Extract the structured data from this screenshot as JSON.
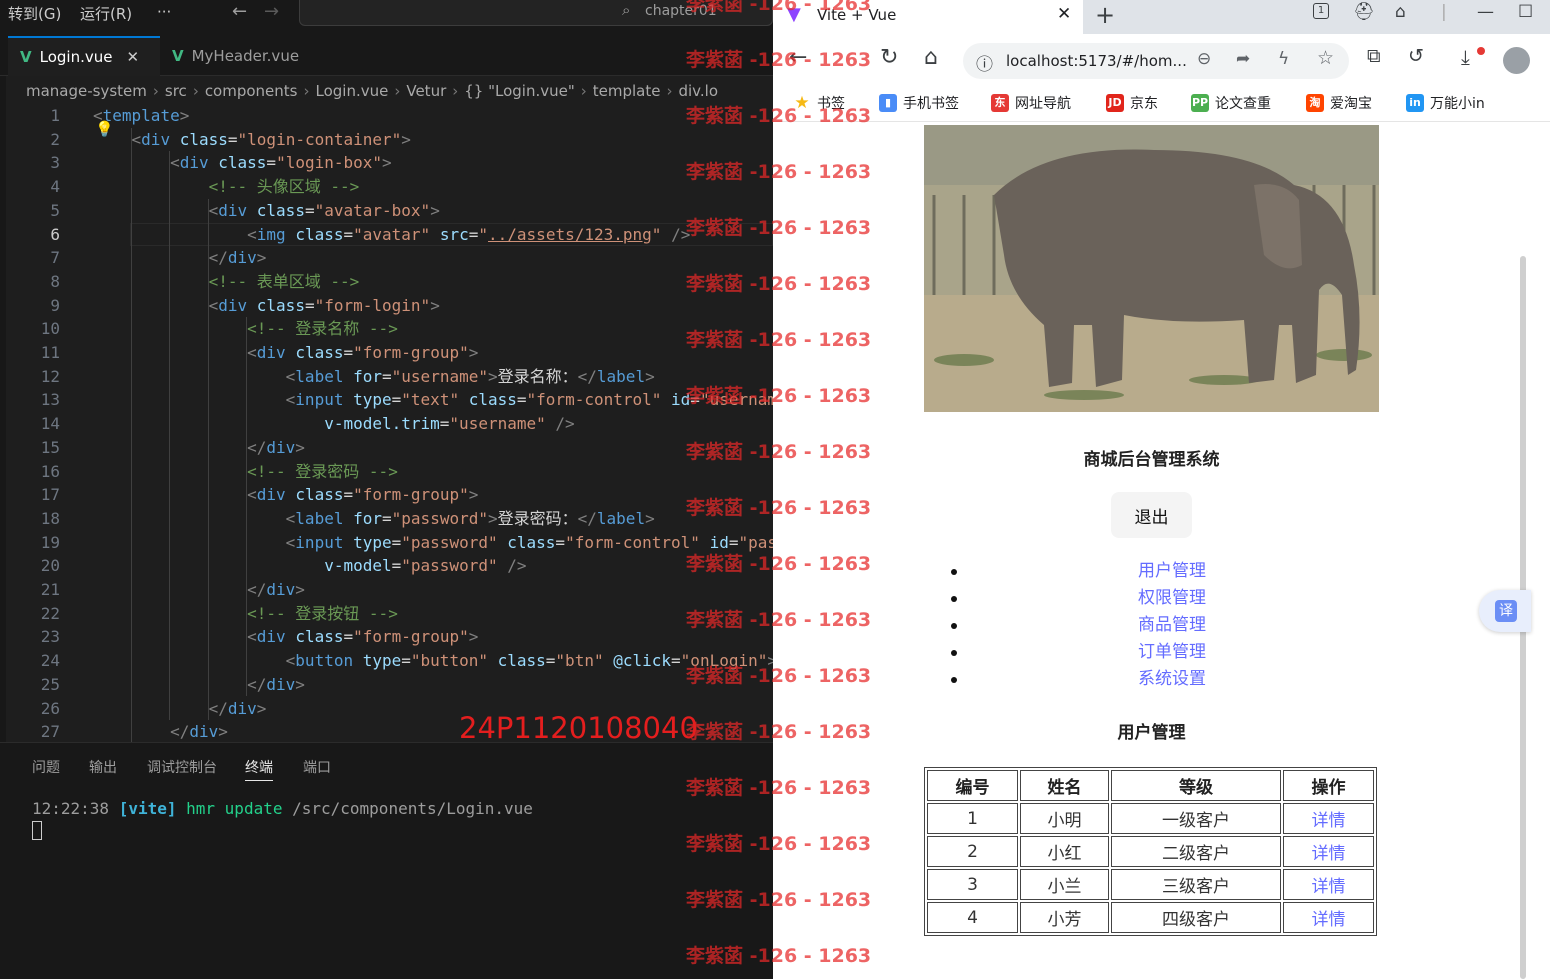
{
  "vscode": {
    "menu": [
      "转到(G)",
      "运行(R)",
      "···"
    ],
    "search_text": "chapter01",
    "tabs": [
      {
        "label": "Login.vue",
        "active": true
      },
      {
        "label": "MyHeader.vue",
        "active": false
      }
    ],
    "tab_close": "✕",
    "breadcrumb": [
      "manage-system",
      "src",
      "components",
      "Login.vue",
      "Vetur",
      "{} \"Login.vue\"",
      "template",
      "div.lo"
    ],
    "code_lines": [
      {
        "n": "1",
        "html": "<span class='p'>&lt;</span><span class='t'>template</span><span class='p'>&gt;</span>"
      },
      {
        "n": "2",
        "html": "    <span class='p'>&lt;</span><span class='t'>div</span> <span class='a'>class</span><span class='x'>=</span><span class='s'>\"login-container\"</span><span class='p'>&gt;</span>"
      },
      {
        "n": "3",
        "html": "        <span class='p'>&lt;</span><span class='t'>div</span> <span class='a'>class</span><span class='x'>=</span><span class='s'>\"login-box\"</span><span class='p'>&gt;</span>"
      },
      {
        "n": "4",
        "html": "            <span class='c'>&lt;!-- 头像区域 --&gt;</span>"
      },
      {
        "n": "5",
        "html": "            <span class='p'>&lt;</span><span class='t'>div</span> <span class='a'>class</span><span class='x'>=</span><span class='s'>\"avatar-box\"</span><span class='p'>&gt;</span>"
      },
      {
        "n": "6",
        "html": "                <span class='p'>&lt;</span><span class='t'>img</span> <span class='a'>class</span><span class='x'>=</span><span class='s'>\"avatar\"</span> <span class='a'>src</span><span class='x'>=</span><span class='s'>\"<u>../assets/123.png</u>\"</span> <span class='p'>/&gt;</span>",
        "current": true
      },
      {
        "n": "7",
        "html": "            <span class='p'>&lt;/</span><span class='t'>div</span><span class='p'>&gt;</span>"
      },
      {
        "n": "8",
        "html": "            <span class='c'>&lt;!-- 表单区域 --&gt;</span>"
      },
      {
        "n": "9",
        "html": "            <span class='p'>&lt;</span><span class='t'>div</span> <span class='a'>class</span><span class='x'>=</span><span class='s'>\"form-login\"</span><span class='p'>&gt;</span>"
      },
      {
        "n": "10",
        "html": "                <span class='c'>&lt;!-- 登录名称 --&gt;</span>"
      },
      {
        "n": "11",
        "html": "                <span class='p'>&lt;</span><span class='t'>div</span> <span class='a'>class</span><span class='x'>=</span><span class='s'>\"form-group\"</span><span class='p'>&gt;</span>"
      },
      {
        "n": "12",
        "html": "                    <span class='p'>&lt;</span><span class='t'>label</span> <span class='a'>for</span><span class='x'>=</span><span class='s'>\"username\"</span><span class='p'>&gt;</span><span class='x'>登录名称：</span><span class='p'>&lt;/</span><span class='t'>label</span><span class='p'>&gt;</span>"
      },
      {
        "n": "13",
        "html": "                    <span class='p'>&lt;</span><span class='t'>input</span> <span class='a'>type</span><span class='x'>=</span><span class='s'>\"text\"</span> <span class='a'>class</span><span class='x'>=</span><span class='s'>\"form-control\"</span> <span class='a'>id</span><span class='x'>=</span><span class='s'>\"usernam</span>"
      },
      {
        "n": "14",
        "html": "                        <span class='a'>v-model.trim</span><span class='x'>=</span><span class='s'>\"username\"</span> <span class='p'>/&gt;</span>"
      },
      {
        "n": "15",
        "html": "                <span class='p'>&lt;/</span><span class='t'>div</span><span class='p'>&gt;</span>"
      },
      {
        "n": "16",
        "html": "                <span class='c'>&lt;!-- 登录密码 --&gt;</span>"
      },
      {
        "n": "17",
        "html": "                <span class='p'>&lt;</span><span class='t'>div</span> <span class='a'>class</span><span class='x'>=</span><span class='s'>\"form-group\"</span><span class='p'>&gt;</span>"
      },
      {
        "n": "18",
        "html": "                    <span class='p'>&lt;</span><span class='t'>label</span> <span class='a'>for</span><span class='x'>=</span><span class='s'>\"password\"</span><span class='p'>&gt;</span><span class='x'>登录密码：</span><span class='p'>&lt;/</span><span class='t'>label</span><span class='p'>&gt;</span>"
      },
      {
        "n": "19",
        "html": "                    <span class='p'>&lt;</span><span class='t'>input</span> <span class='a'>type</span><span class='x'>=</span><span class='s'>\"password\"</span> <span class='a'>class</span><span class='x'>=</span><span class='s'>\"form-control\"</span> <span class='a'>id</span><span class='x'>=</span><span class='s'>\"pas</span>"
      },
      {
        "n": "20",
        "html": "                        <span class='a'>v-model</span><span class='x'>=</span><span class='s'>\"password\"</span> <span class='p'>/&gt;</span>"
      },
      {
        "n": "21",
        "html": "                <span class='p'>&lt;/</span><span class='t'>div</span><span class='p'>&gt;</span>"
      },
      {
        "n": "22",
        "html": "                <span class='c'>&lt;!-- 登录按钮 --&gt;</span>"
      },
      {
        "n": "23",
        "html": "                <span class='p'>&lt;</span><span class='t'>div</span> <span class='a'>class</span><span class='x'>=</span><span class='s'>\"form-group\"</span><span class='p'>&gt;</span>"
      },
      {
        "n": "24",
        "html": "                    <span class='p'>&lt;</span><span class='t'>button</span> <span class='a'>type</span><span class='x'>=</span><span class='s'>\"button\"</span> <span class='a'>class</span><span class='x'>=</span><span class='s'>\"btn\"</span> <span class='a'>@click</span><span class='x'>=</span><span class='s'>\"onLogin\"</span><span class='p'>&gt;</span>"
      },
      {
        "n": "25",
        "html": "                <span class='p'>&lt;/</span><span class='t'>div</span><span class='p'>&gt;</span>"
      },
      {
        "n": "26",
        "html": "            <span class='p'>&lt;/</span><span class='t'>div</span><span class='p'>&gt;</span>"
      },
      {
        "n": "27",
        "html": "        <span class='p'>&lt;/</span><span class='t'>div</span><span class='p'>&gt;</span>"
      }
    ],
    "panel_tabs": [
      {
        "label": "问题",
        "active": false
      },
      {
        "label": "输出",
        "active": false
      },
      {
        "label": "调试控制台",
        "active": false
      },
      {
        "label": "终端",
        "active": true
      },
      {
        "label": "端口",
        "active": false
      }
    ],
    "terminal": {
      "time": "12:22:38",
      "tag": "[vite]",
      "event": "hmr update",
      "path": "/src/components/Login.vue"
    }
  },
  "browser": {
    "tab_title": "Vite + Vue",
    "tab_close": "✕",
    "new_tab": "+",
    "url": "localhost:5173/#/hom...",
    "bookmarks": [
      {
        "label": "书签",
        "icon": "star-icon",
        "color": "#f6b915",
        "glyph": "★"
      },
      {
        "label": "手机书签",
        "icon": "phone-icon",
        "color": "#4a8cf7",
        "glyph": "▮"
      },
      {
        "label": "网址导航",
        "icon": "nav-icon",
        "color": "#e53935",
        "glyph": "东"
      },
      {
        "label": "京东",
        "icon": "jd-icon",
        "color": "#e1251b",
        "glyph": "JD"
      },
      {
        "label": "论文查重",
        "icon": "paper-check-icon",
        "color": "#4caf50",
        "glyph": "PP"
      },
      {
        "label": "爱淘宝",
        "icon": "taobao-icon",
        "color": "#ff4400",
        "glyph": "淘"
      },
      {
        "label": "万能小in",
        "icon": "xiaoin-icon",
        "color": "#2196f3",
        "glyph": "in"
      }
    ]
  },
  "page": {
    "title": "商城后台管理系统",
    "logout": "退出",
    "menu": [
      "用户管理",
      "权限管理",
      "商品管理",
      "订单管理",
      "系统设置"
    ],
    "section_title": "用户管理",
    "table": {
      "headers": [
        "编号",
        "姓名",
        "等级",
        "操作"
      ],
      "rows": [
        [
          "1",
          "小明",
          "一级客户",
          "详情"
        ],
        [
          "2",
          "小红",
          "二级客户",
          "详情"
        ],
        [
          "3",
          "小兰",
          "三级客户",
          "详情"
        ],
        [
          "4",
          "小芳",
          "四级客户",
          "详情"
        ]
      ]
    },
    "translate_label": "译",
    "link_color": "#646cff"
  },
  "overlay": {
    "watermark": "李紫菡 -126 - 1263",
    "stamp": "24P1120108040"
  }
}
